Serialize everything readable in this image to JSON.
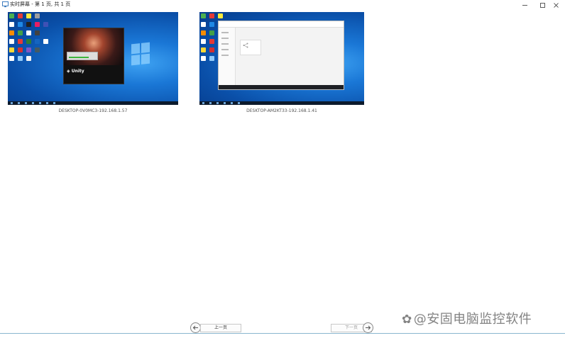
{
  "window": {
    "title": "实时屏幕 - 第 1 页, 共 1 页",
    "controls": {
      "minimize": "–",
      "maximize": "☐",
      "close": "✕"
    }
  },
  "screens": [
    {
      "caption": "DESKTOP-0V0MC3-192.168.1.57",
      "app": "Unity",
      "icon": "unity-icon"
    },
    {
      "caption": "DESKTOP-AM2KT33-192.168.1.41",
      "app": "browser-window",
      "icon": "share-icon"
    }
  ],
  "pager": {
    "prev_label": "上一页",
    "next_label": "下一页",
    "prev_icon": "arrow-left-icon",
    "next_icon": "arrow-right-icon",
    "next_disabled": true
  },
  "watermark": "@安固电脑监控软件",
  "colors": {
    "accent": "#1a77d6",
    "taskbar": "#0c1a2c",
    "bottom_line": "#8ab6cf"
  }
}
